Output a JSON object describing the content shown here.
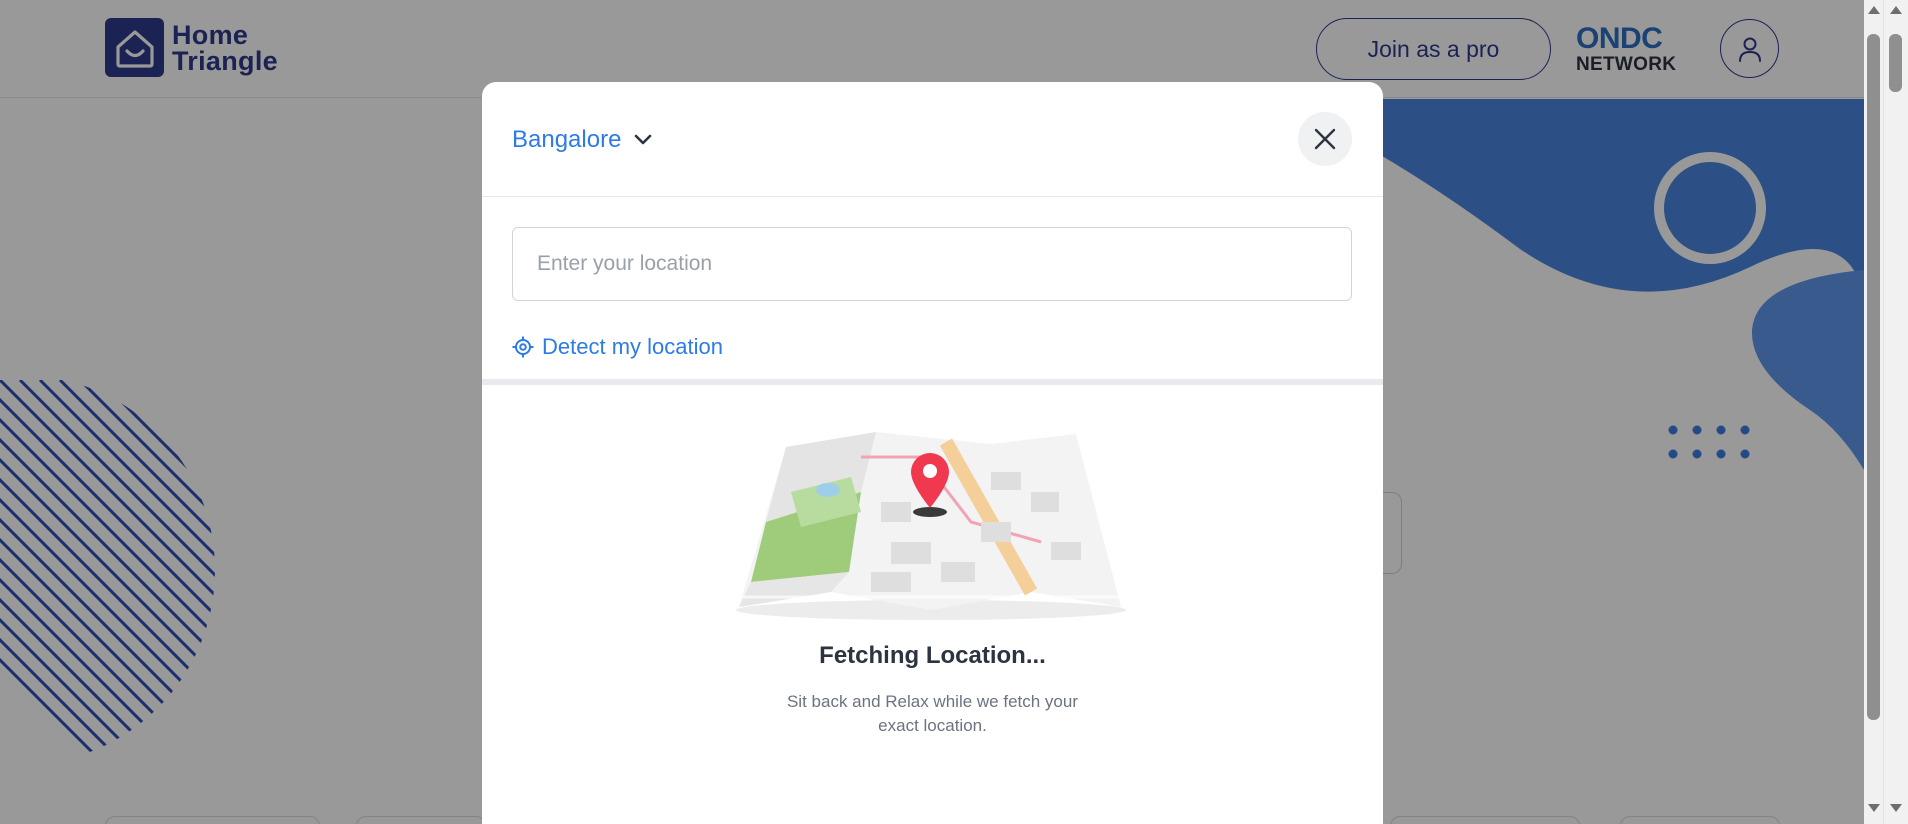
{
  "header": {
    "logo": {
      "line1": "Home",
      "line2": "Triangle"
    },
    "join_label": "Join as a pro",
    "ondc": {
      "top": "ONDC",
      "bottom": "NETWORK"
    }
  },
  "modal": {
    "city": "Bangalore",
    "location_input": {
      "placeholder": "Enter your location",
      "value": ""
    },
    "detect_label": "Detect my location",
    "fetch_title": "Fetching Location...",
    "fetch_subtitle": "Sit back and Relax while we fetch your exact location."
  },
  "colors": {
    "brand_navy": "#2e3a8c",
    "link_blue": "#2e7be6",
    "hero_blue": "#3b82e6",
    "pin_red": "#f0384f"
  },
  "icons": {
    "logo": "house-icon",
    "city_dropdown": "chevron-down-icon",
    "close": "close-icon",
    "detect": "crosshair-icon",
    "profile": "user-icon"
  }
}
